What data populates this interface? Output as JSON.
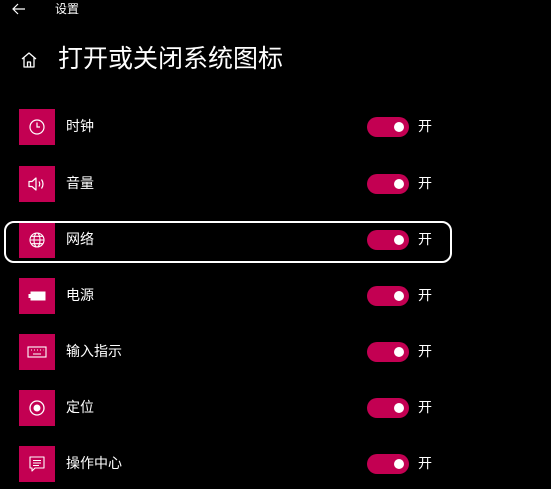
{
  "window": {
    "title": "设置"
  },
  "header": {
    "title": "打开或关闭系统图标"
  },
  "colors": {
    "accent": "#c30052",
    "background": "#000000",
    "text": "#ffffff"
  },
  "items": [
    {
      "label": "时钟",
      "icon": "clock-icon",
      "state_label": "开",
      "on": true
    },
    {
      "label": "音量",
      "icon": "speaker-icon",
      "state_label": "开",
      "on": true
    },
    {
      "label": "网络",
      "icon": "globe-icon",
      "state_label": "开",
      "on": true
    },
    {
      "label": "电源",
      "icon": "battery-icon",
      "state_label": "开",
      "on": true
    },
    {
      "label": "输入指示",
      "icon": "keyboard-icon",
      "state_label": "开",
      "on": true
    },
    {
      "label": "定位",
      "icon": "location-icon",
      "state_label": "开",
      "on": true
    },
    {
      "label": "操作中心",
      "icon": "action-center-icon",
      "state_label": "开",
      "on": true
    }
  ],
  "highlighted_item": "网络"
}
